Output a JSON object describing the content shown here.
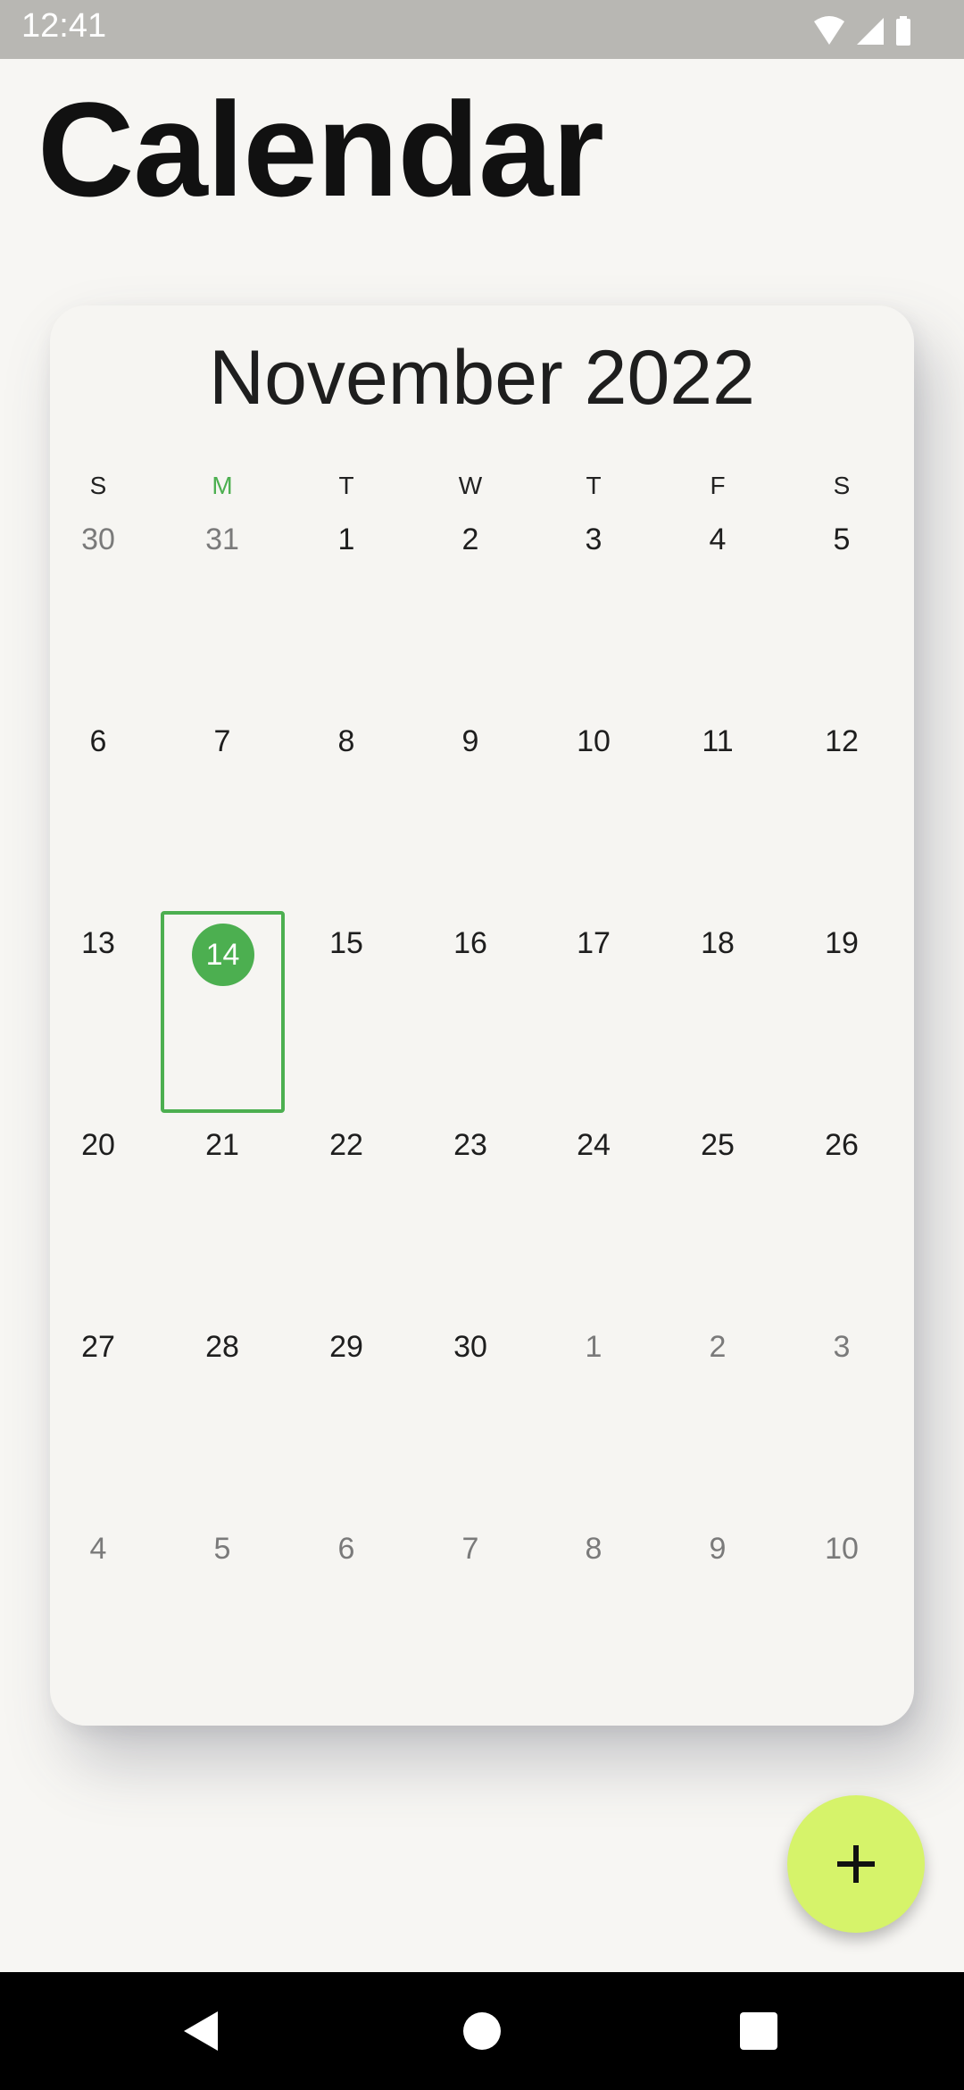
{
  "status_bar": {
    "time": "12:41",
    "icons": [
      "wifi-icon",
      "cell-signal-icon",
      "battery-icon"
    ]
  },
  "app_title": "Calendar",
  "calendar": {
    "month_title": "November 2022",
    "weekdays": [
      "S",
      "M",
      "T",
      "W",
      "T",
      "F",
      "S"
    ],
    "current_weekday_index": 1,
    "selected_date": "14",
    "weeks": [
      [
        {
          "d": "30",
          "o": true
        },
        {
          "d": "31",
          "o": true
        },
        {
          "d": "1"
        },
        {
          "d": "2"
        },
        {
          "d": "3"
        },
        {
          "d": "4"
        },
        {
          "d": "5"
        }
      ],
      [
        {
          "d": "6"
        },
        {
          "d": "7"
        },
        {
          "d": "8"
        },
        {
          "d": "9"
        },
        {
          "d": "10"
        },
        {
          "d": "11"
        },
        {
          "d": "12"
        }
      ],
      [
        {
          "d": "13"
        },
        {
          "d": "14",
          "selected": true
        },
        {
          "d": "15"
        },
        {
          "d": "16"
        },
        {
          "d": "17"
        },
        {
          "d": "18"
        },
        {
          "d": "19"
        }
      ],
      [
        {
          "d": "20"
        },
        {
          "d": "21"
        },
        {
          "d": "22"
        },
        {
          "d": "23"
        },
        {
          "d": "24"
        },
        {
          "d": "25"
        },
        {
          "d": "26"
        }
      ],
      [
        {
          "d": "27"
        },
        {
          "d": "28"
        },
        {
          "d": "29"
        },
        {
          "d": "30"
        },
        {
          "d": "1",
          "o": true
        },
        {
          "d": "2",
          "o": true
        },
        {
          "d": "3",
          "o": true
        }
      ],
      [
        {
          "d": "4",
          "o": true
        },
        {
          "d": "5",
          "o": true
        },
        {
          "d": "6",
          "o": true
        },
        {
          "d": "7",
          "o": true
        },
        {
          "d": "8",
          "o": true
        },
        {
          "d": "9",
          "o": true
        },
        {
          "d": "10",
          "o": true
        }
      ]
    ]
  },
  "fab": {
    "icon": "plus-icon",
    "color": "#d6f36a"
  },
  "colors": {
    "accent": "#4caf50",
    "background": "#f7f6f3",
    "card": "#f6f5f2",
    "other_month_text": "#7a7a7a"
  },
  "nav_bar": {
    "buttons": [
      "back-icon",
      "home-icon",
      "recents-icon"
    ]
  }
}
